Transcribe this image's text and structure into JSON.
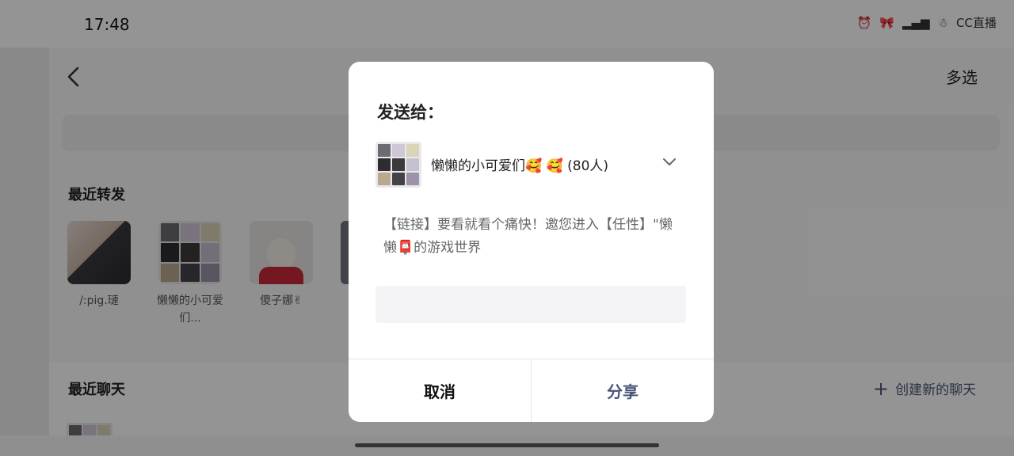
{
  "status_bar": {
    "time": "17:48",
    "icons": [
      "alarm-icon",
      "bow-icon",
      "signal-icon",
      "snowman-icon",
      "app-indicator-icon"
    ],
    "indicator_text": "CC直播"
  },
  "header": {
    "multi_select_label": "多选"
  },
  "recent_forward": {
    "title": "最近转发",
    "items": [
      {
        "name": "/:pig.璉"
      },
      {
        "name": "懒懒的小可爱们..."
      },
      {
        "name": "傻子娜✌"
      }
    ]
  },
  "recent_chats": {
    "title": "最近聊天",
    "create_label": "创建新的聊天"
  },
  "dialog": {
    "title": "发送给：",
    "group_name": "懒懒的小可爱们🥰 🥰 (80人)",
    "message": "【链接】要看就看个痛快！邀您进入【任性】\"懒懒📮的游戏世界",
    "input_value": "",
    "cancel_label": "取消",
    "share_label": "分享"
  },
  "colors": {
    "accent": "#4a5577",
    "overlay": "rgba(0,0,0,0.42)",
    "dialog_bg": "#ffffff"
  }
}
